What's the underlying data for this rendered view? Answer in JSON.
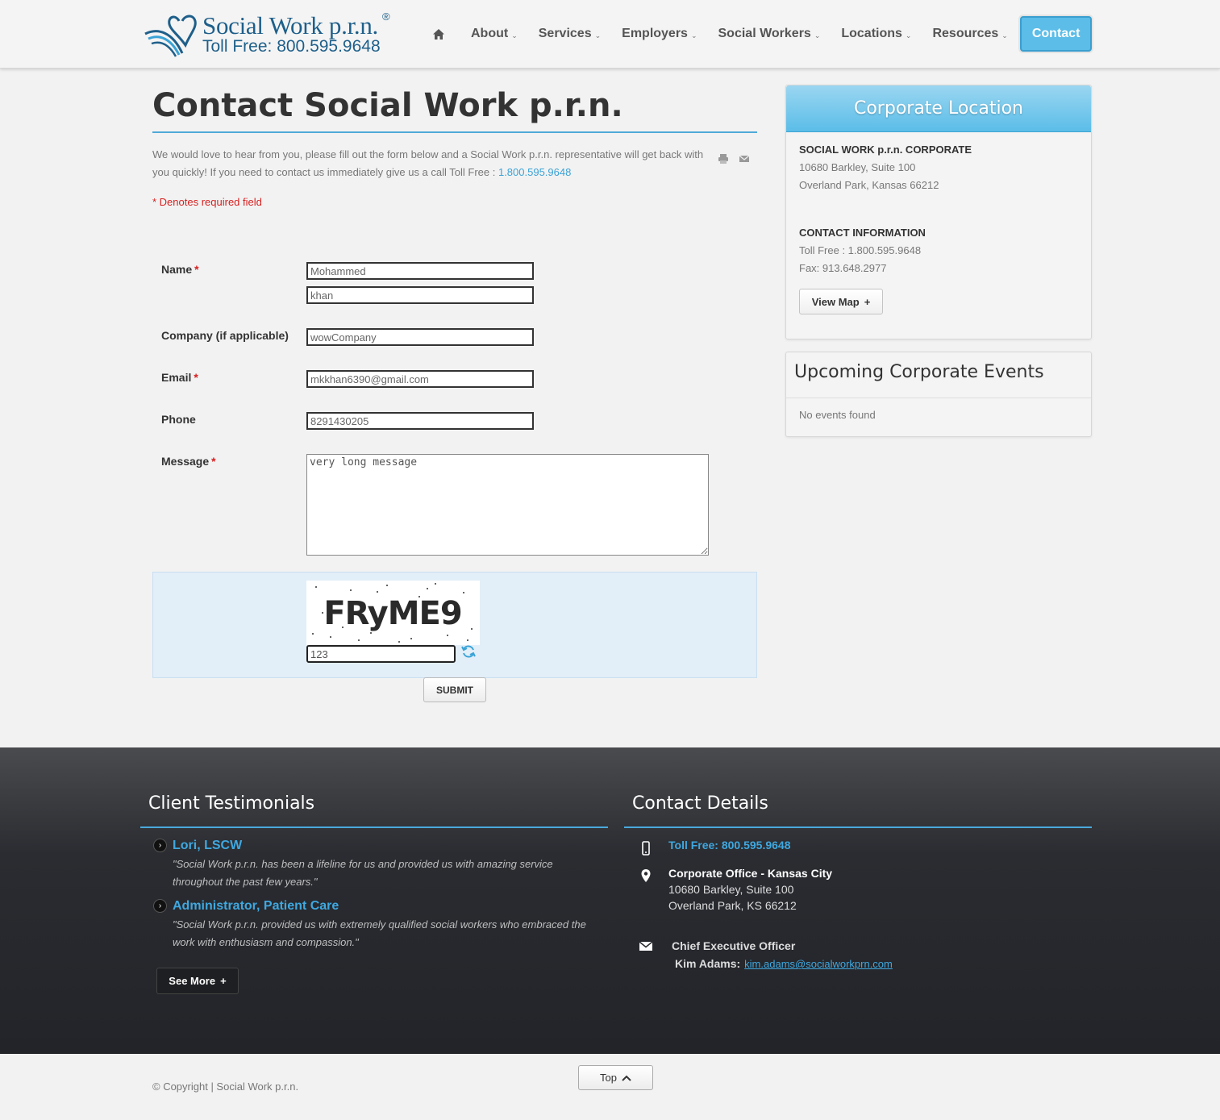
{
  "header": {
    "logo_name": "Social Work p.r.n.",
    "logo_reg": "®",
    "logo_toll": "Toll Free:  800.595.9648",
    "nav": [
      {
        "label": "About"
      },
      {
        "label": "Services"
      },
      {
        "label": "Employers"
      },
      {
        "label": "Social Workers"
      },
      {
        "label": "Locations"
      },
      {
        "label": "Resources"
      }
    ],
    "caret": "⌄",
    "contact_label": "Contact"
  },
  "main": {
    "title": "Contact Social Work p.r.n.",
    "intro_text": "We would love to hear from you, please fill out the form below and a Social Work p.r.n. representative will get back with you quickly!  If you need to contact us immediately give us a call Toll Free : ",
    "intro_phone": "1.800.595.9648",
    "required_note": "* Denotes required field"
  },
  "form": {
    "required_mark": "*",
    "name_label": "Name",
    "first_name": "Mohammed",
    "last_name": "khan",
    "company_label": "Company (if applicable)",
    "company": "wowCompany",
    "email_label": "Email",
    "email": "mkkhan6390@gmail.com",
    "phone_label": "Phone",
    "phone": "8291430205",
    "message_label": "Message",
    "message": "very long message",
    "captcha_text": "FRyME9",
    "captcha_value": "123",
    "submit_label": "SUBMIT"
  },
  "sidebar": {
    "location_title": "Corporate Location",
    "corp_name": "SOCIAL WORK p.r.n. CORPORATE",
    "address1": "10680 Barkley, Suite 100",
    "address2": "Overland Park, Kansas  66212",
    "contact_heading": "CONTACT INFORMATION",
    "toll_free": "Toll Free : 1.800.595.9648",
    "fax": "Fax: 913.648.2977",
    "view_map_label": "View Map",
    "plus": "+",
    "events_title": "Upcoming Corporate Events",
    "no_events": "No events found"
  },
  "footer": {
    "testimonials_title": "Client Testimonials",
    "testimonials": [
      {
        "name": "Lori, LSCW",
        "quote": "\"Social Work p.r.n. has been a lifeline for us and provided us with amazing service throughout the past few years.\""
      },
      {
        "name": "Administrator, Patient Care",
        "quote": "\"Social Work p.r.n. provided us with extremely qualified social workers who embraced the work with enthusiasm and compassion.\""
      }
    ],
    "see_more_label": "See More",
    "contact_title": "Contact Details",
    "toll_free": "Toll Free:  800.595.9648",
    "office_name": "Corporate Office - Kansas City",
    "office_address1": "10680 Barkley, Suite 100",
    "office_address2": "Overland Park, KS  66212",
    "ceo_title": "Chief Executive Officer",
    "ceo_name": "Kim Adams:",
    "ceo_email": "kim.adams@socialworkprn.com"
  },
  "bottom": {
    "copyright": "© Copyright | Social Work p.r.n.",
    "top_label": "Top"
  },
  "colors": {
    "accent": "#5bbde8",
    "link": "#3ba3d6",
    "required": "#d61f1f",
    "brand": "#1e5f8a"
  }
}
